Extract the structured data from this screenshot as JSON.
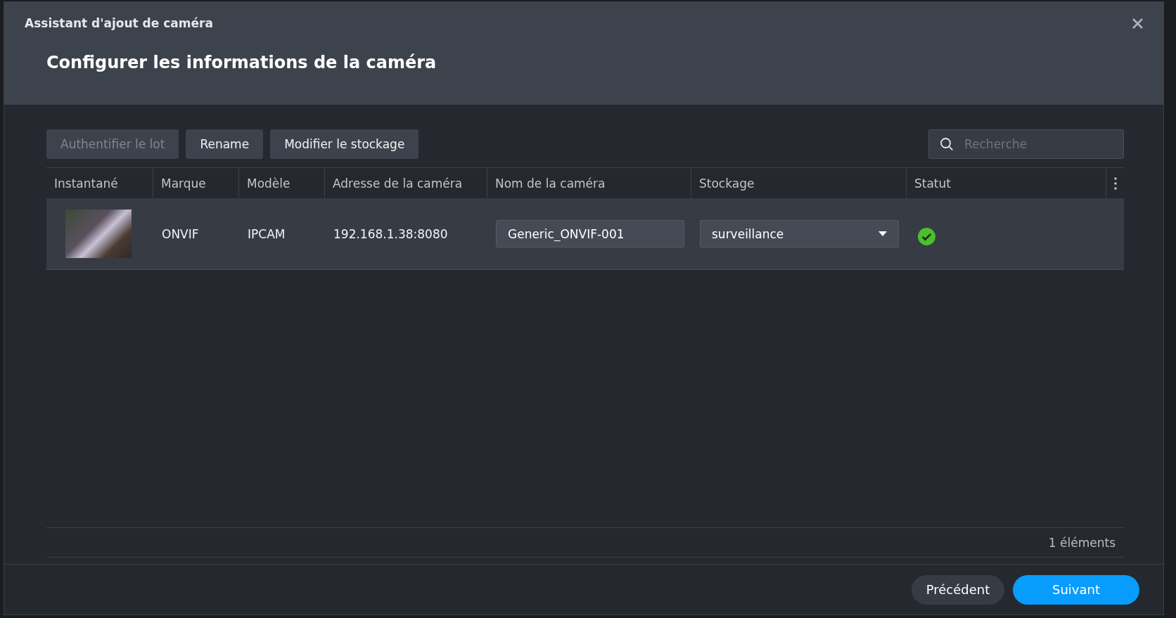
{
  "window": {
    "title": "Assistant d'ajout de caméra"
  },
  "heading": "Configurer les informations de la caméra",
  "toolbar": {
    "buttons": [
      {
        "label": "Authentifier le lot",
        "disabled": true
      },
      {
        "label": "Rename",
        "disabled": false
      },
      {
        "label": "Modifier le stockage",
        "disabled": false
      }
    ],
    "search": {
      "placeholder": "Recherche"
    }
  },
  "table": {
    "columns": [
      "Instantané",
      "Marque",
      "Modèle",
      "Adresse de la caméra",
      "Nom de la caméra",
      "Stockage",
      "Statut"
    ],
    "rows": [
      {
        "brand": "ONVIF",
        "model": "IPCAM",
        "address": "192.168.1.38:8080",
        "name": "Generic_ONVIF-001",
        "storage": "surveillance",
        "connected": true
      }
    ]
  },
  "count": "1 éléments",
  "footer": {
    "buttons": [
      {
        "label": "Précédent",
        "kind": "secondary"
      },
      {
        "label": "Suivant",
        "kind": "primary"
      }
    ]
  }
}
